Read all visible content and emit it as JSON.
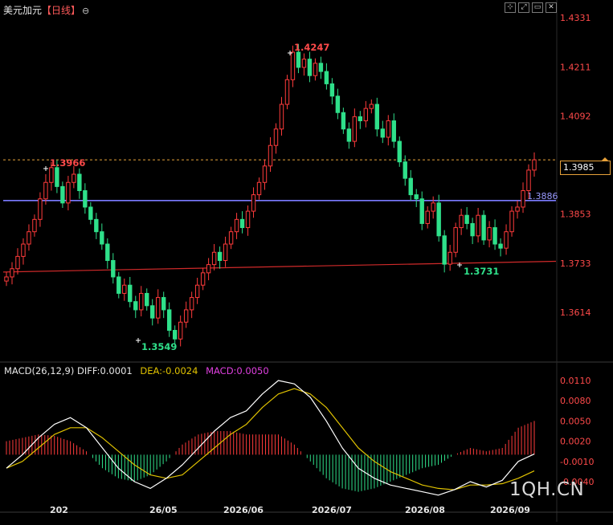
{
  "header": {
    "instrument": "美元加元",
    "interval": "【日线】",
    "toggle_glyph": "⊖"
  },
  "toolbar": {
    "icons": [
      "crosshair-icon",
      "expand-icon",
      "window-icon",
      "close-icon"
    ],
    "glyphs": [
      "⊹",
      "⤢",
      "▭",
      "✕"
    ]
  },
  "colors": {
    "up": "#ff3b3b",
    "down": "#2fe08a",
    "support": "#d02a2a",
    "resistance": "#7b7bff",
    "last_price_line": "#e8a23a",
    "diff_line": "#ffffff",
    "dea_line": "#e0c200",
    "axis_text": "#ff4a4a"
  },
  "price_panel": {
    "y_ticks": [
      "1.4331",
      "1.4211",
      "1.4092",
      "1.3853",
      "1.3733",
      "1.3614"
    ],
    "y_tick_values": [
      1.4331,
      1.4211,
      1.4092,
      1.3853,
      1.3733,
      1.3614
    ],
    "last_price": "1.3985",
    "last_price_value": 1.3985,
    "hline_value_label": "1.3886",
    "hline_value": 1.3886,
    "annotations": {
      "high": "1.4247",
      "early_high": "1.3966",
      "low": "1.3549",
      "later_low": "1.3731"
    }
  },
  "macd_panel": {
    "title": "MACD(26,12,9)",
    "diff_label": "DIFF:0.0001",
    "dea_label": "DEA:-0.0024",
    "macd_label": "MACD:0.0050",
    "y_ticks": [
      "0.0110",
      "0.0080",
      "0.0050",
      "0.0020",
      "-0.0010",
      "-0.0040"
    ],
    "y_tick_values": [
      0.011,
      0.008,
      0.005,
      0.002,
      -0.001,
      -0.004
    ]
  },
  "x_axis": {
    "labels": [
      "202",
      "26/05",
      "2026/06",
      "2026/07",
      "2026/08",
      "2026/09"
    ]
  },
  "watermark": "1QH.CN",
  "chart_data": {
    "type": "candlestick",
    "symbol": "美元加元",
    "interval": "日线",
    "close_series": [
      1.37,
      1.372,
      1.375,
      1.378,
      1.381,
      1.384,
      1.389,
      1.393,
      1.3966,
      1.392,
      1.388,
      1.393,
      1.395,
      1.391,
      1.387,
      1.384,
      1.381,
      1.378,
      1.374,
      1.37,
      1.366,
      1.368,
      1.364,
      1.362,
      1.366,
      1.363,
      1.36,
      1.365,
      1.362,
      1.357,
      1.3549,
      1.359,
      1.362,
      1.365,
      1.368,
      1.371,
      1.373,
      1.376,
      1.374,
      1.378,
      1.381,
      1.384,
      1.382,
      1.386,
      1.39,
      1.393,
      1.397,
      1.402,
      1.406,
      1.412,
      1.418,
      1.4247,
      1.421,
      1.423,
      1.419,
      1.422,
      1.42,
      1.417,
      1.414,
      1.41,
      1.406,
      1.403,
      1.409,
      1.408,
      1.411,
      1.412,
      1.406,
      1.404,
      1.408,
      1.403,
      1.398,
      1.394,
      1.39,
      1.389,
      1.383,
      1.386,
      1.388,
      1.38,
      1.3731,
      1.376,
      1.382,
      1.385,
      1.383,
      1.38,
      1.385,
      1.379,
      1.382,
      1.378,
      1.377,
      1.381,
      1.386,
      1.387,
      1.391,
      1.396,
      1.3985
    ],
    "macd": {
      "diff": [
        -0.002,
        0.0,
        0.0025,
        0.0045,
        0.0055,
        0.004,
        0.001,
        -0.002,
        -0.004,
        -0.005,
        -0.0035,
        -0.0015,
        0.001,
        0.0035,
        0.0055,
        0.0065,
        0.009,
        0.011,
        0.0105,
        0.0085,
        0.005,
        0.001,
        -0.002,
        -0.0035,
        -0.0045,
        -0.005,
        -0.0055,
        -0.006,
        -0.0052,
        -0.004,
        -0.0048,
        -0.0038,
        -0.001,
        0.0001
      ],
      "dea": [
        -0.002,
        -0.001,
        0.001,
        0.003,
        0.004,
        0.004,
        0.0025,
        0.0005,
        -0.0015,
        -0.003,
        -0.0035,
        -0.003,
        -0.001,
        0.001,
        0.003,
        0.0045,
        0.007,
        0.009,
        0.0098,
        0.009,
        0.007,
        0.004,
        0.001,
        -0.001,
        -0.0025,
        -0.0035,
        -0.0045,
        -0.005,
        -0.0052,
        -0.0045,
        -0.0045,
        -0.0043,
        -0.0035,
        -0.0024
      ],
      "hist": [
        0.002,
        0.0025,
        0.003,
        0.0028,
        0.002,
        0.0005,
        -0.002,
        -0.0035,
        -0.004,
        -0.003,
        -0.001,
        0.0015,
        0.003,
        0.0035,
        0.0035,
        0.003,
        0.003,
        0.003,
        0.0015,
        -0.001,
        -0.0035,
        -0.005,
        -0.0055,
        -0.005,
        -0.004,
        -0.003,
        -0.002,
        -0.0015,
        0.0,
        0.001,
        0.0005,
        0.001,
        0.004,
        0.005
      ]
    }
  }
}
